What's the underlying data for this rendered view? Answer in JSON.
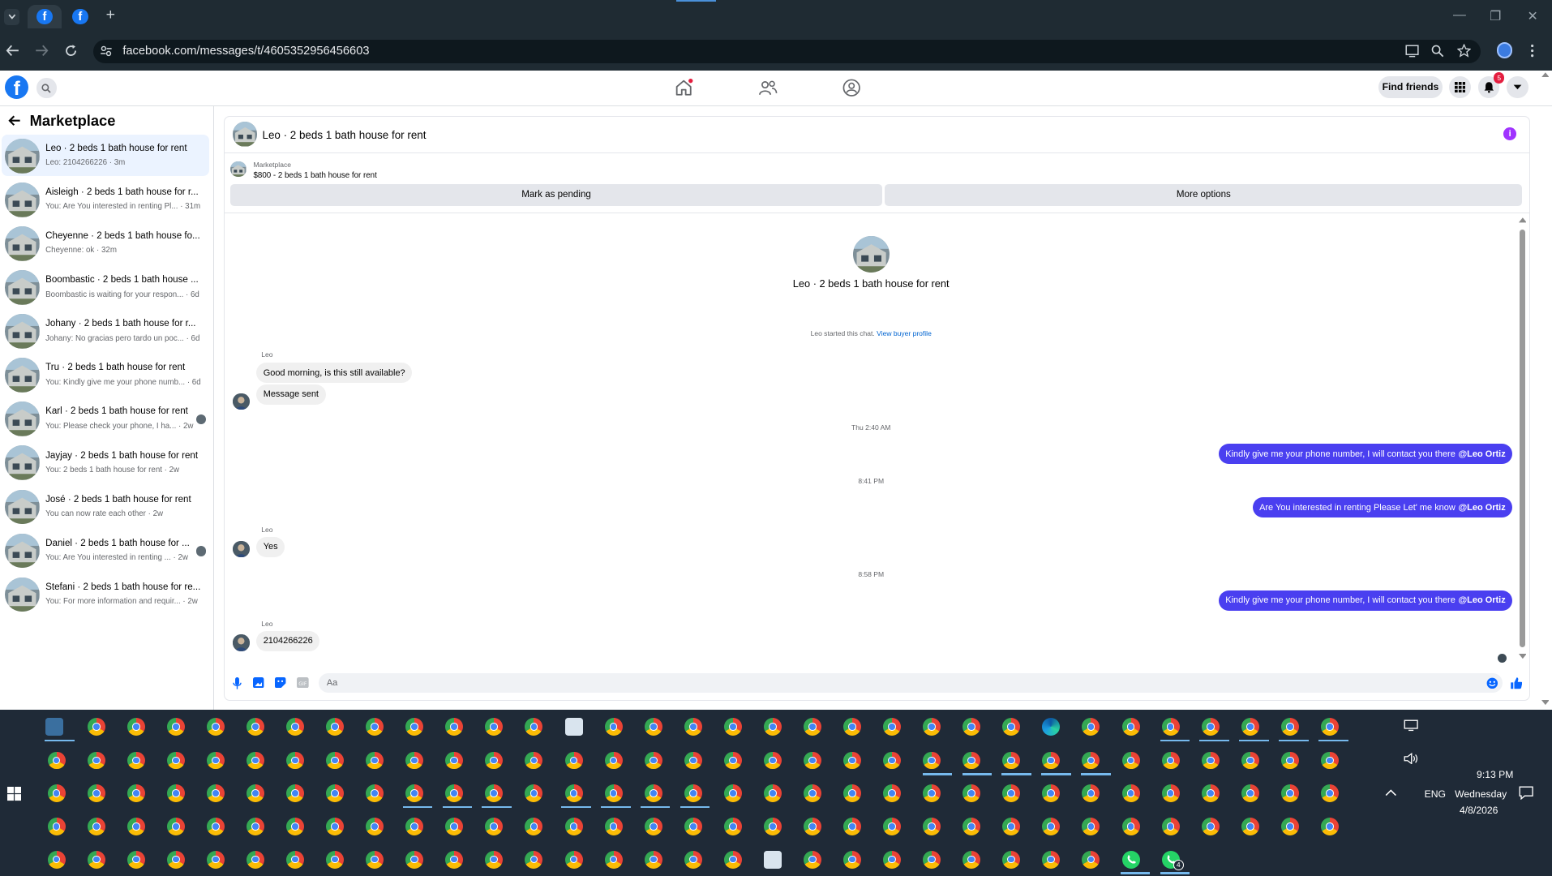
{
  "browser": {
    "url": "facebook.com/messages/t/4605352956456603",
    "new_tab_label": "+",
    "window_controls": [
      "—",
      "❐",
      "✕"
    ]
  },
  "fb_nav": {
    "find_friends_label": "Find friends",
    "notification_count": "5",
    "logo_letter": "f"
  },
  "sidebar": {
    "title": "Marketplace",
    "conversations": [
      {
        "name": "Leo · 2 beds 1 bath house for rent",
        "preview": "Leo: 2104266226 · 3m",
        "selected": true
      },
      {
        "name": "Aisleigh · 2 beds 1 bath house for r...",
        "preview": "You: Are You interested in renting Pl... · 31m"
      },
      {
        "name": "Cheyenne · 2 beds 1 bath house fo...",
        "preview": "Cheyenne: ok · 32m"
      },
      {
        "name": "Boombastic · 2 beds 1 bath house ...",
        "preview": "Boombastic is waiting for your respon... · 6d"
      },
      {
        "name": "Johany · 2 beds 1 bath house for r...",
        "preview": "Johany: No gracias pero tardo un poc... · 6d"
      },
      {
        "name": "Tru · 2 beds 1 bath house for rent",
        "preview": "You: Kindly give me your phone numb... · 6d"
      },
      {
        "name": "Karl · 2 beds 1 bath house for rent",
        "preview": "You: Please check your phone, I ha... · 2w"
      },
      {
        "name": "Jayjay · 2 beds 1 bath house for rent",
        "preview": "You: 2 beds 1 bath house for rent · 2w"
      },
      {
        "name": "José · 2 beds 1 bath house for rent",
        "preview": "You can now rate each other · 2w"
      },
      {
        "name": "Daniel · 2 beds 1 bath house for ...",
        "preview": "You: Are You interested in renting ... · 2w"
      },
      {
        "name": "Stefani · 2 beds 1 bath house for re...",
        "preview": "You: For more information and requir... · 2w"
      }
    ]
  },
  "chat": {
    "title": "Leo · 2 beds 1 bath house for rent",
    "listing_label": "Marketplace",
    "listing_price": "$800 - 2 beds 1 bath house for rent",
    "mark_pending_label": "Mark as pending",
    "more_options_label": "More options",
    "intro_title": "Leo · 2 beds 1 bath house for rent",
    "started_text": "Leo started this chat.",
    "view_profile_label": "View buyer profile",
    "sender_name": "Leo",
    "incoming1": "Good morning, is this still available?",
    "incoming2": "Message sent",
    "time1": "Thu 2:40 AM",
    "outgoing1_text": "Kindly give me your phone number, I will contact you there",
    "mention": "@Leo Ortiz",
    "time2": "8:41 PM",
    "outgoing2_text": "Are You  interested in renting Please Let' me know",
    "incoming3": "Yes",
    "time3": "8:58 PM",
    "outgoing3_text": "Kindly give me your phone number, I will contact you there",
    "incoming4": "2104266226",
    "composer_placeholder": "Aa"
  },
  "taskbar": {
    "time": "9:13 PM",
    "day": "Wednesday",
    "date": "4/8/2026",
    "language": "ENG",
    "whatsapp_badge": "4"
  },
  "colors": {
    "fb_blue": "#1877f2",
    "outgoing_bubble": "#4a3ff0",
    "chrome_dark": "#1f2b33",
    "taskbar": "#1f2a37"
  }
}
